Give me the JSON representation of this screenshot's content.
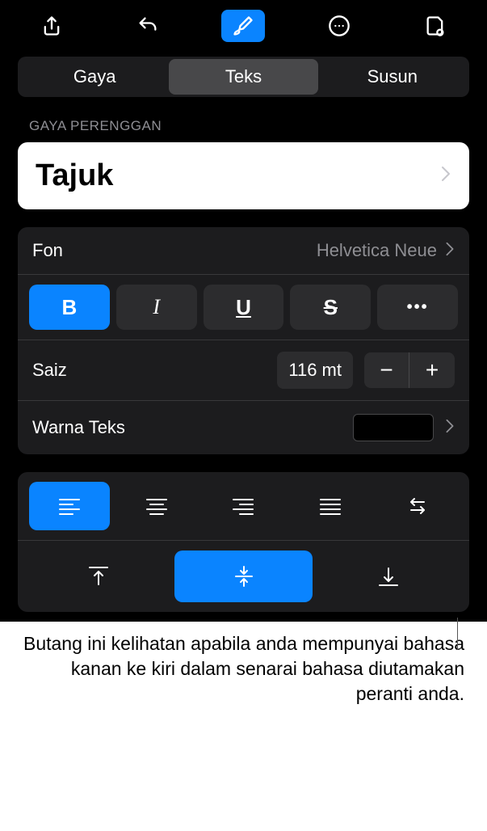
{
  "toolbar": {
    "icons": [
      "share-icon",
      "undo-icon",
      "brush-icon",
      "more-icon",
      "document-icon"
    ]
  },
  "tabs": {
    "items": [
      "Gaya",
      "Teks",
      "Susun"
    ],
    "active": 1
  },
  "section_label": "GAYA PERENGGAN",
  "style_name": "Tajuk",
  "font": {
    "label": "Fon",
    "value": "Helvetica Neue"
  },
  "format_buttons": {
    "bold": "B",
    "italic": "I",
    "underline": "U",
    "strike": "S",
    "more": "•••"
  },
  "size": {
    "label": "Saiz",
    "value": "116 mt"
  },
  "text_color": {
    "label": "Warna Teks",
    "value": "#000000"
  },
  "caption": "Butang ini kelihatan apabila anda mempunyai bahasa kanan ke kiri dalam senarai bahasa diutamakan peranti anda."
}
